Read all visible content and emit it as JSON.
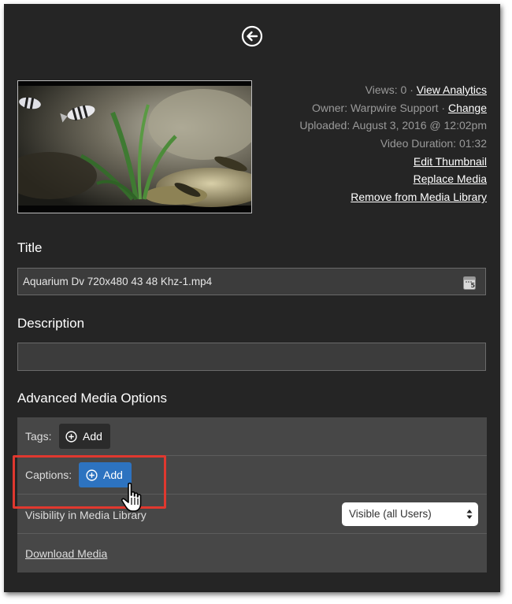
{
  "meta": {
    "views_text": "Views: 0 · ",
    "view_analytics": "View Analytics",
    "owner_text": "Owner: Warpwire Support · ",
    "change": "Change",
    "uploaded_text": "Uploaded: August 3, 2016 @ 12:02pm",
    "duration_text": "Video Duration: 01:32",
    "edit_thumbnail": "Edit Thumbnail",
    "replace_media": "Replace Media",
    "remove_media": "Remove from Media Library"
  },
  "title_section": {
    "label": "Title",
    "value": "Aquarium Dv 720x480 43 48 Khz-1.mp4"
  },
  "description_section": {
    "label": "Description",
    "value": ""
  },
  "advanced": {
    "label": "Advanced Media Options",
    "tags_label": "Tags:",
    "tags_add": "Add",
    "captions_label": "Captions:",
    "captions_add": "Add",
    "visibility_label": "Visibility in Media Library",
    "visibility_value": "Visible (all Users)",
    "download_media": "Download Media"
  },
  "icons": {
    "back": "arrow-left-circle-icon",
    "calendar": "calendar-icon",
    "plus": "plus-circle-icon",
    "cursor": "hand-pointer-icon"
  },
  "colors": {
    "panel_bg": "#252525",
    "primary_button": "#2d73c0",
    "highlight": "#e0382f"
  }
}
